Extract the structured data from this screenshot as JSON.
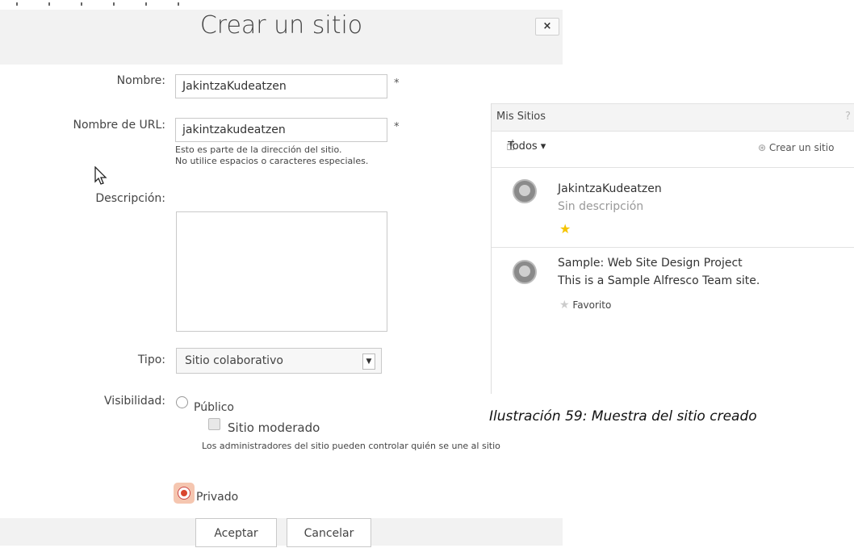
{
  "dialog": {
    "title": "Crear un sitio",
    "close": "×",
    "name_label": "Nombre:",
    "name_value": "JakintzaKudeatzen",
    "url_label": "Nombre de URL:",
    "url_value": "jakintzakudeatzen",
    "required_mark": "*",
    "url_hint_1": "Esto es parte de la dirección del sitio.",
    "url_hint_2": "No utilice espacios o caracteres especiales.",
    "description_label": "Descripción:",
    "description_value": "",
    "type_label": "Tipo:",
    "type_value": "Sitio colaborativo",
    "visibility_label": "Visibilidad:",
    "public_label": "Público",
    "moderated_label": "Sitio moderado",
    "moderated_hint": "Los administradores del sitio pueden controlar quién se une al sitio",
    "private_label": "Privado",
    "accept_label": "Aceptar",
    "cancel_label": "Cancelar",
    "selected_visibility": "Privado"
  },
  "panel": {
    "title": "Mis Sitios",
    "help": "?",
    "filter": "Todos ▾",
    "create_link": "Crear un sitio",
    "sites": [
      {
        "name": "JakintzaKudeatzen",
        "description": "Sin descripción",
        "favorite": true
      },
      {
        "name": "Sample: Web Site Design Project",
        "description": "This is a Sample Alfresco Team site.",
        "favorite": false,
        "favorite_label": "Favorito"
      }
    ]
  },
  "caption": "Ilustración 59: Muestra del sitio creado",
  "colors": {
    "accent": "#d9452e",
    "star": "#f5c400",
    "header_bg": "#f2f2f2"
  }
}
